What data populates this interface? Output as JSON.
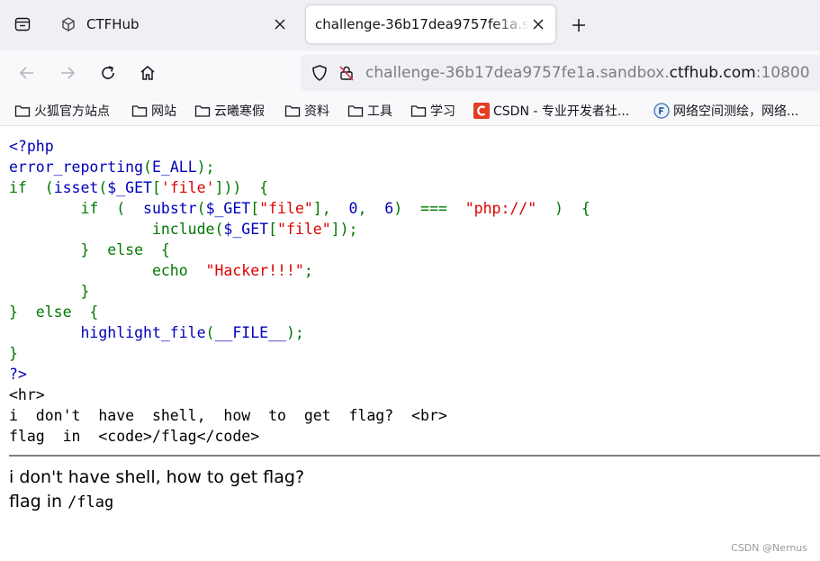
{
  "tabs": [
    {
      "title": "CTFHub",
      "active": false,
      "favicon": "ctfhub-cube-icon"
    },
    {
      "title": "challenge-36b17dea9757fe1a.sandbox.ctfhub.com:10800",
      "active": true
    }
  ],
  "url": {
    "prefix": "challenge-36b17dea9757fe1a.sandbox.",
    "host": "ctfhub.com",
    "suffix": ":10800"
  },
  "bookmarks": [
    {
      "label": "火狐官方站点",
      "icon": "folder-icon"
    },
    {
      "label": "网站",
      "icon": "folder-icon"
    },
    {
      "label": "云曦寒假",
      "icon": "folder-icon"
    },
    {
      "label": "资料",
      "icon": "folder-icon"
    },
    {
      "label": "工具",
      "icon": "folder-icon"
    },
    {
      "label": "学习",
      "icon": "folder-icon"
    },
    {
      "label": "CSDN - 专业开发者社...",
      "icon": "csdn-icon"
    },
    {
      "label": "网络空间测绘，网络...",
      "icon": "fofa-icon"
    }
  ],
  "source": {
    "l1": "<?php",
    "l2a": "error_reporting",
    "l2b": "(",
    "l2c": "E_ALL",
    "l2d": ");",
    "l3a": "if  ",
    "l3b": "(",
    "l3c": "isset",
    "l3d": "(",
    "l3e": "$_GET",
    "l3f": "[",
    "l3g": "'file'",
    "l3h": "]))  {",
    "l4a": "        if  (  ",
    "l4b": "substr",
    "l4c": "(",
    "l4d": "$_GET",
    "l4e": "[",
    "l4f": "\"file\"",
    "l4g": "],  ",
    "l4h": "0",
    "l4i": ",  ",
    "l4j": "6",
    "l4k": ")  ===  ",
    "l4l": "\"php://\"",
    "l4m": "  )  {",
    "l5a": "                include",
    "l5b": "(",
    "l5c": "$_GET",
    "l5d": "[",
    "l5e": "\"file\"",
    "l5f": "]);",
    "l6": "        }  else  {",
    "l7a": "                echo  ",
    "l7b": "\"Hacker!!!\"",
    "l7c": ";",
    "l8": "        }",
    "l9": "}  else  {",
    "l10a": "        highlight_file",
    "l10b": "(",
    "l10c": "__FILE__",
    "l10d": ");",
    "l11": "}",
    "l12": "?>",
    "l13": "<hr>",
    "l14": "i  don't  have  shell,  how  to  get  flag?  <br>",
    "l15": "flag  in  <code>/flag</code>"
  },
  "output": {
    "line1": "i don't have shell, how to get flag?",
    "line2_text": "flag in ",
    "line2_code": "/flag"
  },
  "watermark": "CSDN @Nernus"
}
